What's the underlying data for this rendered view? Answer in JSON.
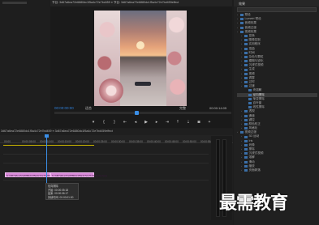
{
  "program": {
    "title": "节目: 3d67a6ea72e6880dc1f5a4c72e7bd459 ≡ 节目: 3d67a6ea72e6880dc1f5a4c72e7bd459effect",
    "timecode_current": "00:00:00:00",
    "fit": "适合",
    "full": "完整",
    "timecode_duration": "00:00:14:05"
  },
  "transport": {
    "buttons": [
      "mark-in",
      "mark-out",
      "go-to-in",
      "step-back",
      "play",
      "step-forward",
      "go-to-out",
      "lift",
      "extract",
      "export-frame",
      "settings"
    ]
  },
  "effects": {
    "title": "效果",
    "items": [
      {
        "label": "预设",
        "level": 0,
        "type": "folder"
      },
      {
        "label": "Lumetri 预设",
        "level": 0,
        "type": "folder"
      },
      {
        "label": "音频效果",
        "level": 0,
        "type": "folder"
      },
      {
        "label": "音频过渡",
        "level": 0,
        "type": "folder"
      },
      {
        "label": "视频效果",
        "level": 0,
        "type": "folder"
      },
      {
        "label": "变换",
        "level": 1,
        "type": "folder"
      },
      {
        "label": "图像控制",
        "level": 1,
        "type": "folder"
      },
      {
        "label": "实用程序",
        "level": 1,
        "type": "folder"
      },
      {
        "label": "扭曲",
        "level": 1,
        "type": "folder"
      },
      {
        "label": "时间",
        "level": 1,
        "type": "folder"
      },
      {
        "label": "杂色与颗粒",
        "level": 1,
        "type": "folder"
      },
      {
        "label": "模糊与锐化",
        "level": 1,
        "type": "folder"
      },
      {
        "label": "沉浸式视频",
        "level": 1,
        "type": "folder"
      },
      {
        "label": "生成",
        "level": 1,
        "type": "folder"
      },
      {
        "label": "视频",
        "level": 1,
        "type": "folder"
      },
      {
        "label": "调整",
        "level": 1,
        "type": "folder"
      },
      {
        "label": "过时",
        "level": 1,
        "type": "folder"
      },
      {
        "label": "过渡",
        "level": 1,
        "type": "folder"
      },
      {
        "label": "块溶解",
        "level": 2,
        "type": "effect"
      },
      {
        "label": "径向擦除",
        "level": 2,
        "type": "effect",
        "selected": true
      },
      {
        "label": "渐变擦除",
        "level": 2,
        "type": "effect"
      },
      {
        "label": "百叶窗",
        "level": 2,
        "type": "effect"
      },
      {
        "label": "线性擦除",
        "level": 2,
        "type": "effect"
      },
      {
        "label": "透视",
        "level": 1,
        "type": "folder"
      },
      {
        "label": "通道",
        "level": 1,
        "type": "folder"
      },
      {
        "label": "键控",
        "level": 1,
        "type": "folder"
      },
      {
        "label": "颜色校正",
        "level": 1,
        "type": "folder"
      },
      {
        "label": "风格化",
        "level": 1,
        "type": "folder"
      },
      {
        "label": "视频过渡",
        "level": 0,
        "type": "folder"
      },
      {
        "label": "3D 运动",
        "level": 1,
        "type": "folder"
      },
      {
        "label": "Iris",
        "level": 1,
        "type": "folder"
      },
      {
        "label": "划像",
        "level": 1,
        "type": "folder"
      },
      {
        "label": "擦除",
        "level": 1,
        "type": "folder"
      },
      {
        "label": "沉浸式视频",
        "level": 1,
        "type": "folder"
      },
      {
        "label": "溶解",
        "level": 1,
        "type": "folder"
      },
      {
        "label": "滑动",
        "level": 1,
        "type": "folder"
      },
      {
        "label": "缩放",
        "level": 1,
        "type": "folder"
      },
      {
        "label": "页面剥落",
        "level": 1,
        "type": "folder"
      }
    ]
  },
  "timeline": {
    "tab": "3d67a6ea72e6880dc1f5a4c72e7bd459 ≡ 3d67a6ea72e6880dc1f5a4c72e7bd459effect",
    "ruler": [
      "00:00",
      "00:00:05:00",
      "00:00:10:00",
      "00:00:15:00",
      "00:00:20:00",
      "00:00:25:00",
      "00:00:30:00",
      "00:00:35:00",
      "00:00:40:00",
      "00:00:45:00",
      "00:00:50:00",
      "00:00:55:00"
    ],
    "clip1_label": "fx 3d67a6ea72e6880dc1f5a4c72e7bd459.jpg",
    "clip2_label": "fx 3d67a6ea72e6880dc1f5a4c72e7bd459effect.jpg",
    "tooltip": {
      "line1": "径向擦除",
      "line2": "开始: 00:00:05:18",
      "line3": "结束: 00:00:06:17",
      "line4": "持续时间: 00:00:01:00"
    }
  },
  "watermark": "最需教育",
  "colors": {
    "accent": "#3a8ee6",
    "clip": "#d88ad8",
    "work_area": "#c8b400"
  }
}
